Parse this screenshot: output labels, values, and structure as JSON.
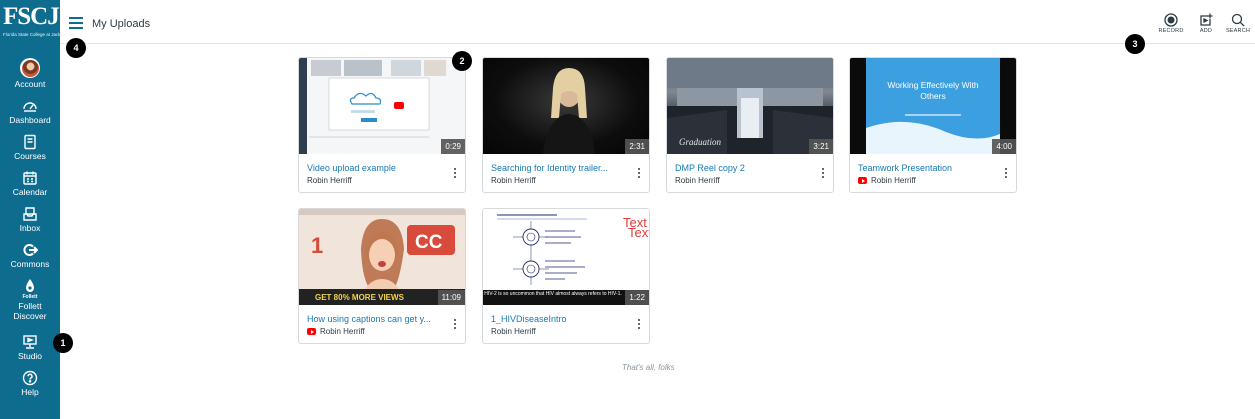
{
  "app": {
    "logo_text": "FSCJ",
    "logo_subtext": "Florida State College at Jacksonville",
    "page_title": "My Uploads"
  },
  "nav": {
    "account": "Account",
    "dashboard": "Dashboard",
    "courses": "Courses",
    "calendar": "Calendar",
    "inbox": "Inbox",
    "commons": "Commons",
    "follett_mark": "Follett",
    "follett_line1": "Follett",
    "follett_line2": "Discover",
    "studio": "Studio",
    "help": "Help"
  },
  "toolbar": {
    "record": "RECORD",
    "add": "ADD",
    "search": "SEARCH"
  },
  "badges": [
    "1",
    "2",
    "3",
    "4"
  ],
  "videos": [
    {
      "title": "Video upload example",
      "owner": "Robin Herriff",
      "duration": "0:29",
      "youtube": false,
      "thumb_text": ""
    },
    {
      "title": "Searching for Identity trailer...",
      "owner": "Robin Herriff",
      "duration": "2:31",
      "youtube": false,
      "thumb_text": ""
    },
    {
      "title": "DMP Reel copy 2",
      "owner": "Robin Herriff",
      "duration": "3:21",
      "youtube": false,
      "thumb_text": "Graduation"
    },
    {
      "title": "Teamwork Presentation",
      "owner": "Robin Herriff",
      "duration": "4:00",
      "youtube": true,
      "thumb_text": "Working Effectively With Others"
    },
    {
      "title": "How using captions can get y...",
      "owner": "Robin Herriff",
      "duration": "11:09",
      "youtube": true,
      "thumb_text": "GET 80% MORE VIEWS"
    },
    {
      "title": "1_HIVDiseaseIntro",
      "owner": "Robin Herriff",
      "duration": "1:22",
      "youtube": false,
      "thumb_text": "HIV-2 is so uncommon that HIV almost always refers to HIV-1."
    }
  ],
  "thumb_extras": {
    "captions_number": "1",
    "captions_badge": "CC",
    "hiv_overlay_text": "Text"
  },
  "footer_note": "That's all, folks",
  "colors": {
    "nav_bg": "#0e6c8f",
    "link": "#1779b4",
    "text": "#2d3b45",
    "youtube": "#ff0000"
  }
}
